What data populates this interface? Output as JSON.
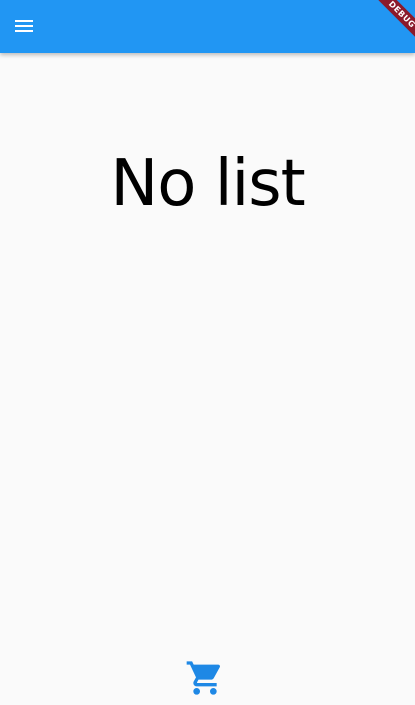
{
  "app_bar": {
    "color": "#2196f3",
    "menu_icon": "menu-icon",
    "debug_banner": "DEBUG",
    "debug_banner_color": "#8b1a2b"
  },
  "main": {
    "empty_message": "No list",
    "background": "#fafafa"
  },
  "bottom": {
    "cart_icon": "shopping-cart-icon",
    "cart_color": "#1e88e5"
  }
}
